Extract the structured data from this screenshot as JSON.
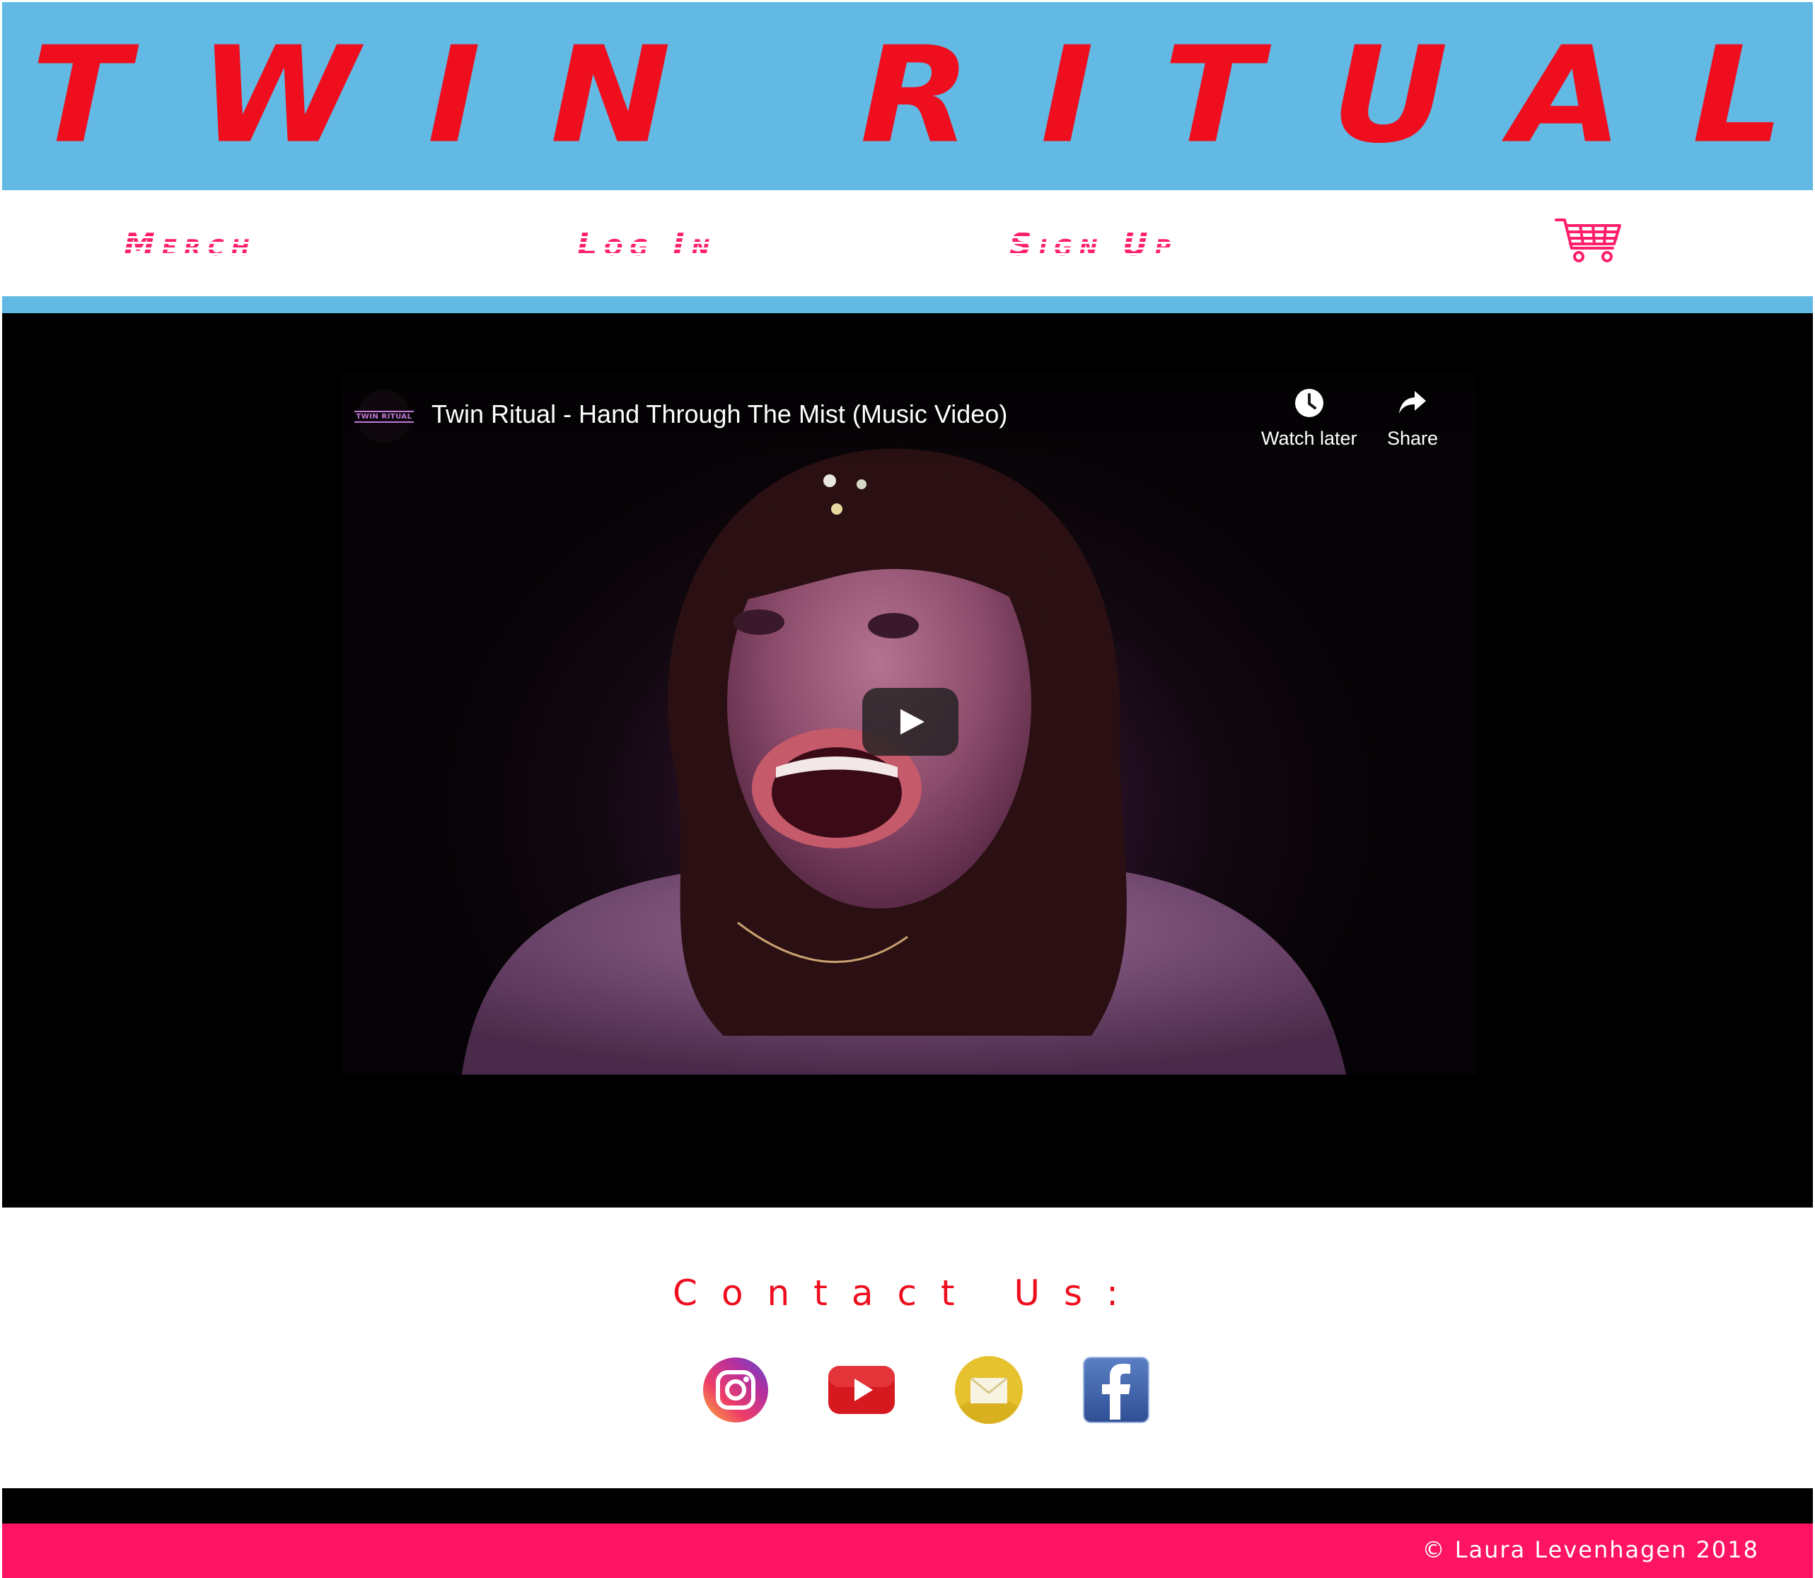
{
  "header": {
    "title": "TWIN RITUAL",
    "background_color": "#62b9e3",
    "title_color": "#ee0e1e"
  },
  "nav": {
    "items": [
      {
        "label": "Merch"
      },
      {
        "label": "Log In"
      },
      {
        "label": "Sign Up"
      }
    ],
    "cart_icon": "shopping-cart-icon",
    "link_color": "#ff1f6c"
  },
  "video": {
    "title": "Twin Ritual - Hand Through The Mist (Music Video)",
    "channel_avatar_text": "TWIN RITUAL",
    "watch_later_label": "Watch later",
    "share_label": "Share",
    "watch_later_icon": "clock-icon",
    "share_icon": "share-arrow-icon",
    "play_icon": "play-icon"
  },
  "contact": {
    "heading": "Contact Us:",
    "links": [
      {
        "icon": "instagram-icon"
      },
      {
        "icon": "youtube-icon"
      },
      {
        "icon": "email-icon"
      },
      {
        "icon": "facebook-icon"
      }
    ]
  },
  "footer": {
    "copyright": "© Laura Levenhagen 2018",
    "accent_color": "#ff1464"
  }
}
